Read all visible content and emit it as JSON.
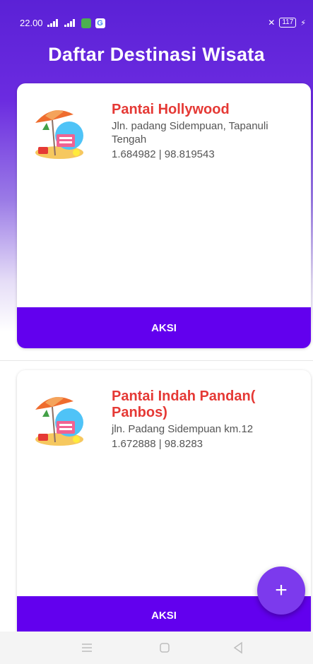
{
  "status_bar": {
    "time": "22.00",
    "battery": "117"
  },
  "header": {
    "title": "Daftar Destinasi Wisata"
  },
  "destinations": [
    {
      "name": "Pantai Hollywood",
      "address": "Jln. padang Sidempuan, Tapanuli Tengah",
      "coordinates": "1.684982 | 98.819543",
      "action_label": "AKSI"
    },
    {
      "name": "Pantai Indah Pandan( Panbos)",
      "address": "jln. Padang Sidempuan km.12",
      "coordinates": "1.672888 | 98.8283",
      "action_label": "AKSI"
    }
  ],
  "fab": {
    "label": "+"
  },
  "colors": {
    "primary": "#6200ee",
    "title_red": "#e53935",
    "fab": "#7c3aed"
  }
}
